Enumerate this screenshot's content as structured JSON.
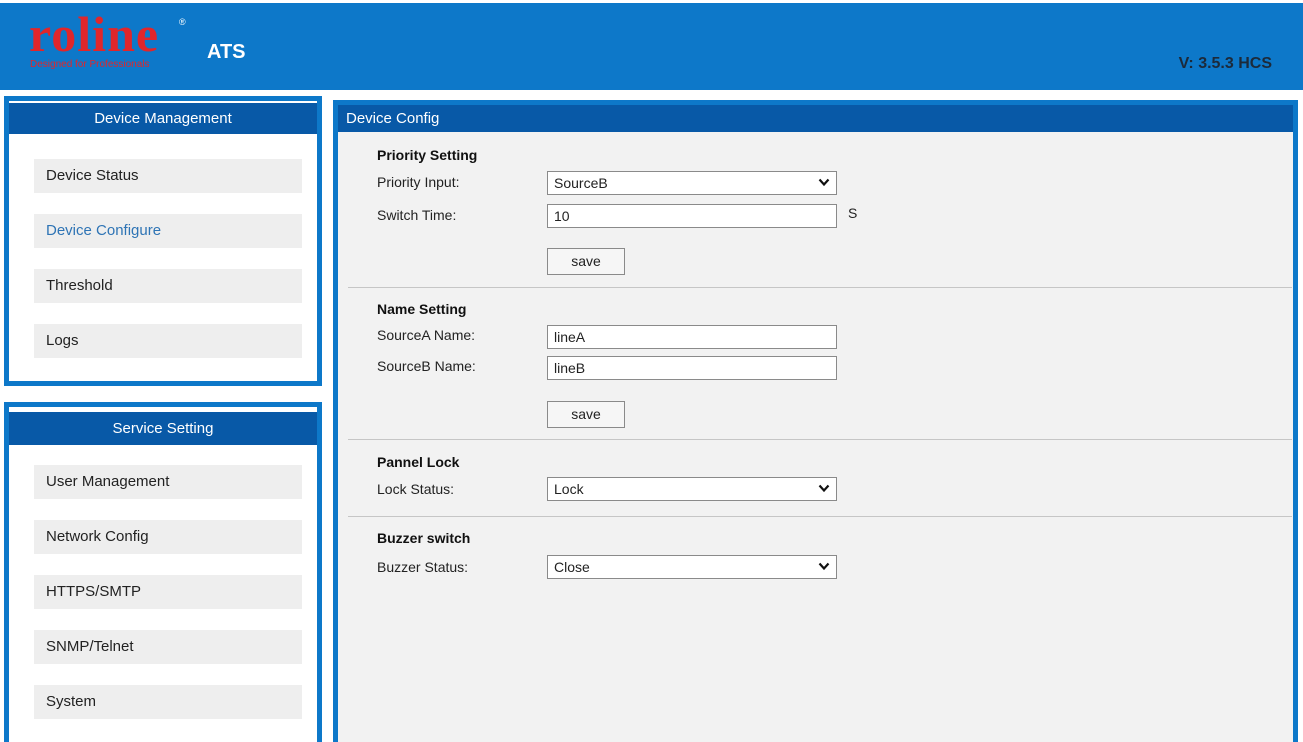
{
  "header": {
    "logo_text": "roline",
    "logo_registered": "®",
    "logo_tagline": "Designed for Professionals",
    "app_title": "ATS",
    "version": "V: 3.5.3 HCS"
  },
  "colors": {
    "header_bg": "#0d78c9",
    "panel_head_bg": "#0859a7",
    "logo_red": "#e0262b",
    "active_link": "#2e74b5"
  },
  "sidebar": {
    "device_management": {
      "title": "Device Management",
      "items": [
        {
          "label": "Device Status",
          "active": false
        },
        {
          "label": "Device Configure",
          "active": true
        },
        {
          "label": "Threshold",
          "active": false
        },
        {
          "label": "Logs",
          "active": false
        }
      ]
    },
    "service_setting": {
      "title": "Service Setting",
      "items": [
        {
          "label": "User Management"
        },
        {
          "label": "Network Config"
        },
        {
          "label": "HTTPS/SMTP"
        },
        {
          "label": "SNMP/Telnet"
        },
        {
          "label": "System"
        }
      ]
    }
  },
  "main": {
    "title": "Device Config",
    "priority": {
      "title": "Priority Setting",
      "input_label": "Priority Input:",
      "input_value": "SourceB",
      "switch_label": "Switch Time:",
      "switch_value": "10",
      "switch_unit": "S",
      "save_label": "save"
    },
    "name": {
      "title": "Name Setting",
      "source_a_label": "SourceA Name:",
      "source_a_value": "lineA",
      "source_b_label": "SourceB Name:",
      "source_b_value": "lineB",
      "save_label": "save"
    },
    "panel_lock": {
      "title": "Pannel Lock",
      "status_label": "Lock Status:",
      "status_value": "Lock"
    },
    "buzzer": {
      "title": "Buzzer switch",
      "status_label": "Buzzer Status:",
      "status_value": "Close"
    }
  }
}
